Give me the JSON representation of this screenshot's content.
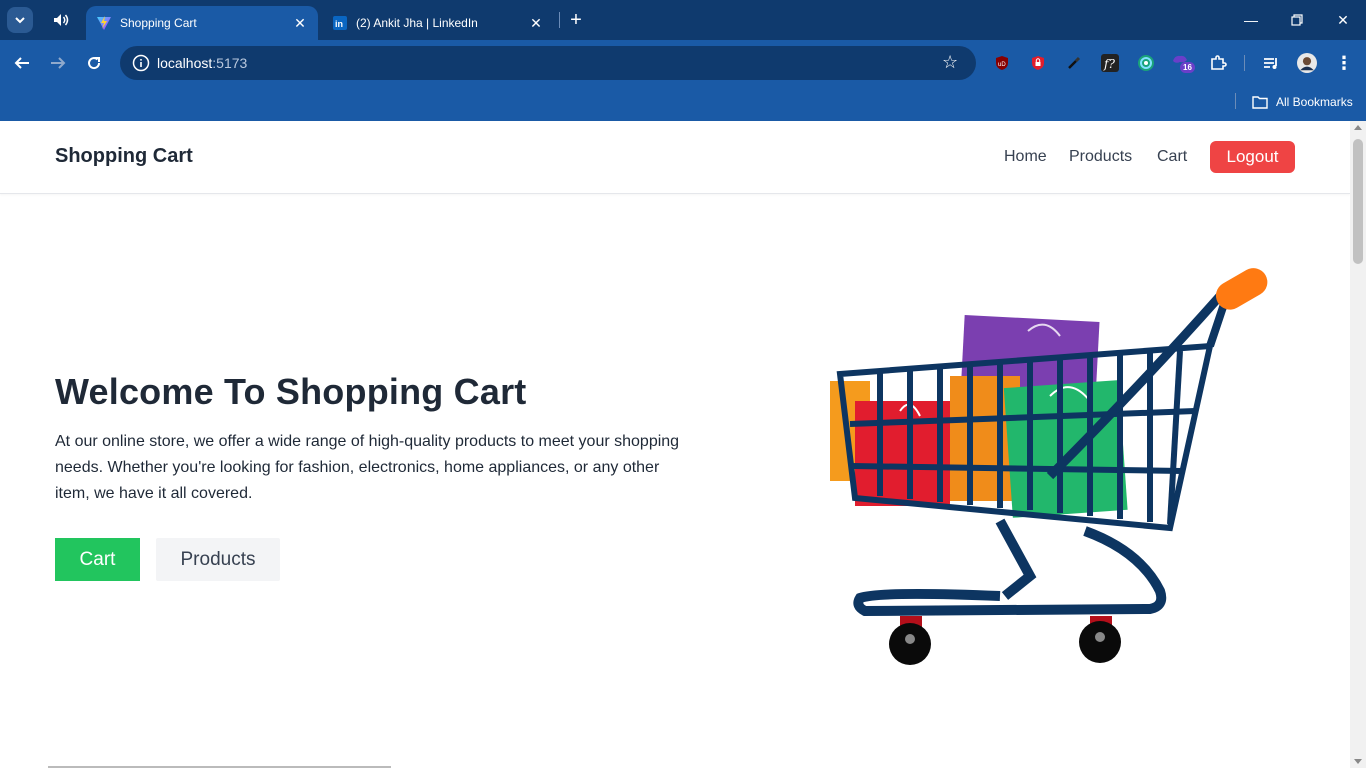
{
  "browser": {
    "tabs": [
      {
        "title": "Shopping Cart",
        "active": true,
        "favicon": "vite-icon"
      },
      {
        "title": "(2) Ankit Jha | LinkedIn",
        "active": false,
        "favicon": "linkedin-icon"
      }
    ],
    "url_host": "localhost",
    "url_port": ":5173",
    "extension_badge": "16",
    "bookmarks_label": "All Bookmarks"
  },
  "navbar": {
    "brand": "Shopping Cart",
    "links": [
      "Home",
      "Products",
      "Cart"
    ],
    "logout_label": "Logout"
  },
  "hero": {
    "title": "Welcome To Shopping Cart",
    "text": "At our online store, we offer a wide range of high-quality products to meet your shopping needs. Whether you're looking for fashion, electronics, home appliances, or any other item, we have it all covered.",
    "cart_button": "Cart",
    "products_button": "Products"
  },
  "colors": {
    "chrome_dark": "#0f3a6e",
    "chrome_blue": "#1a5aa6",
    "logout_red": "#ef4444",
    "cart_green": "#22c55e",
    "products_gray": "#f3f4f6",
    "text_dark": "#1f2937"
  }
}
